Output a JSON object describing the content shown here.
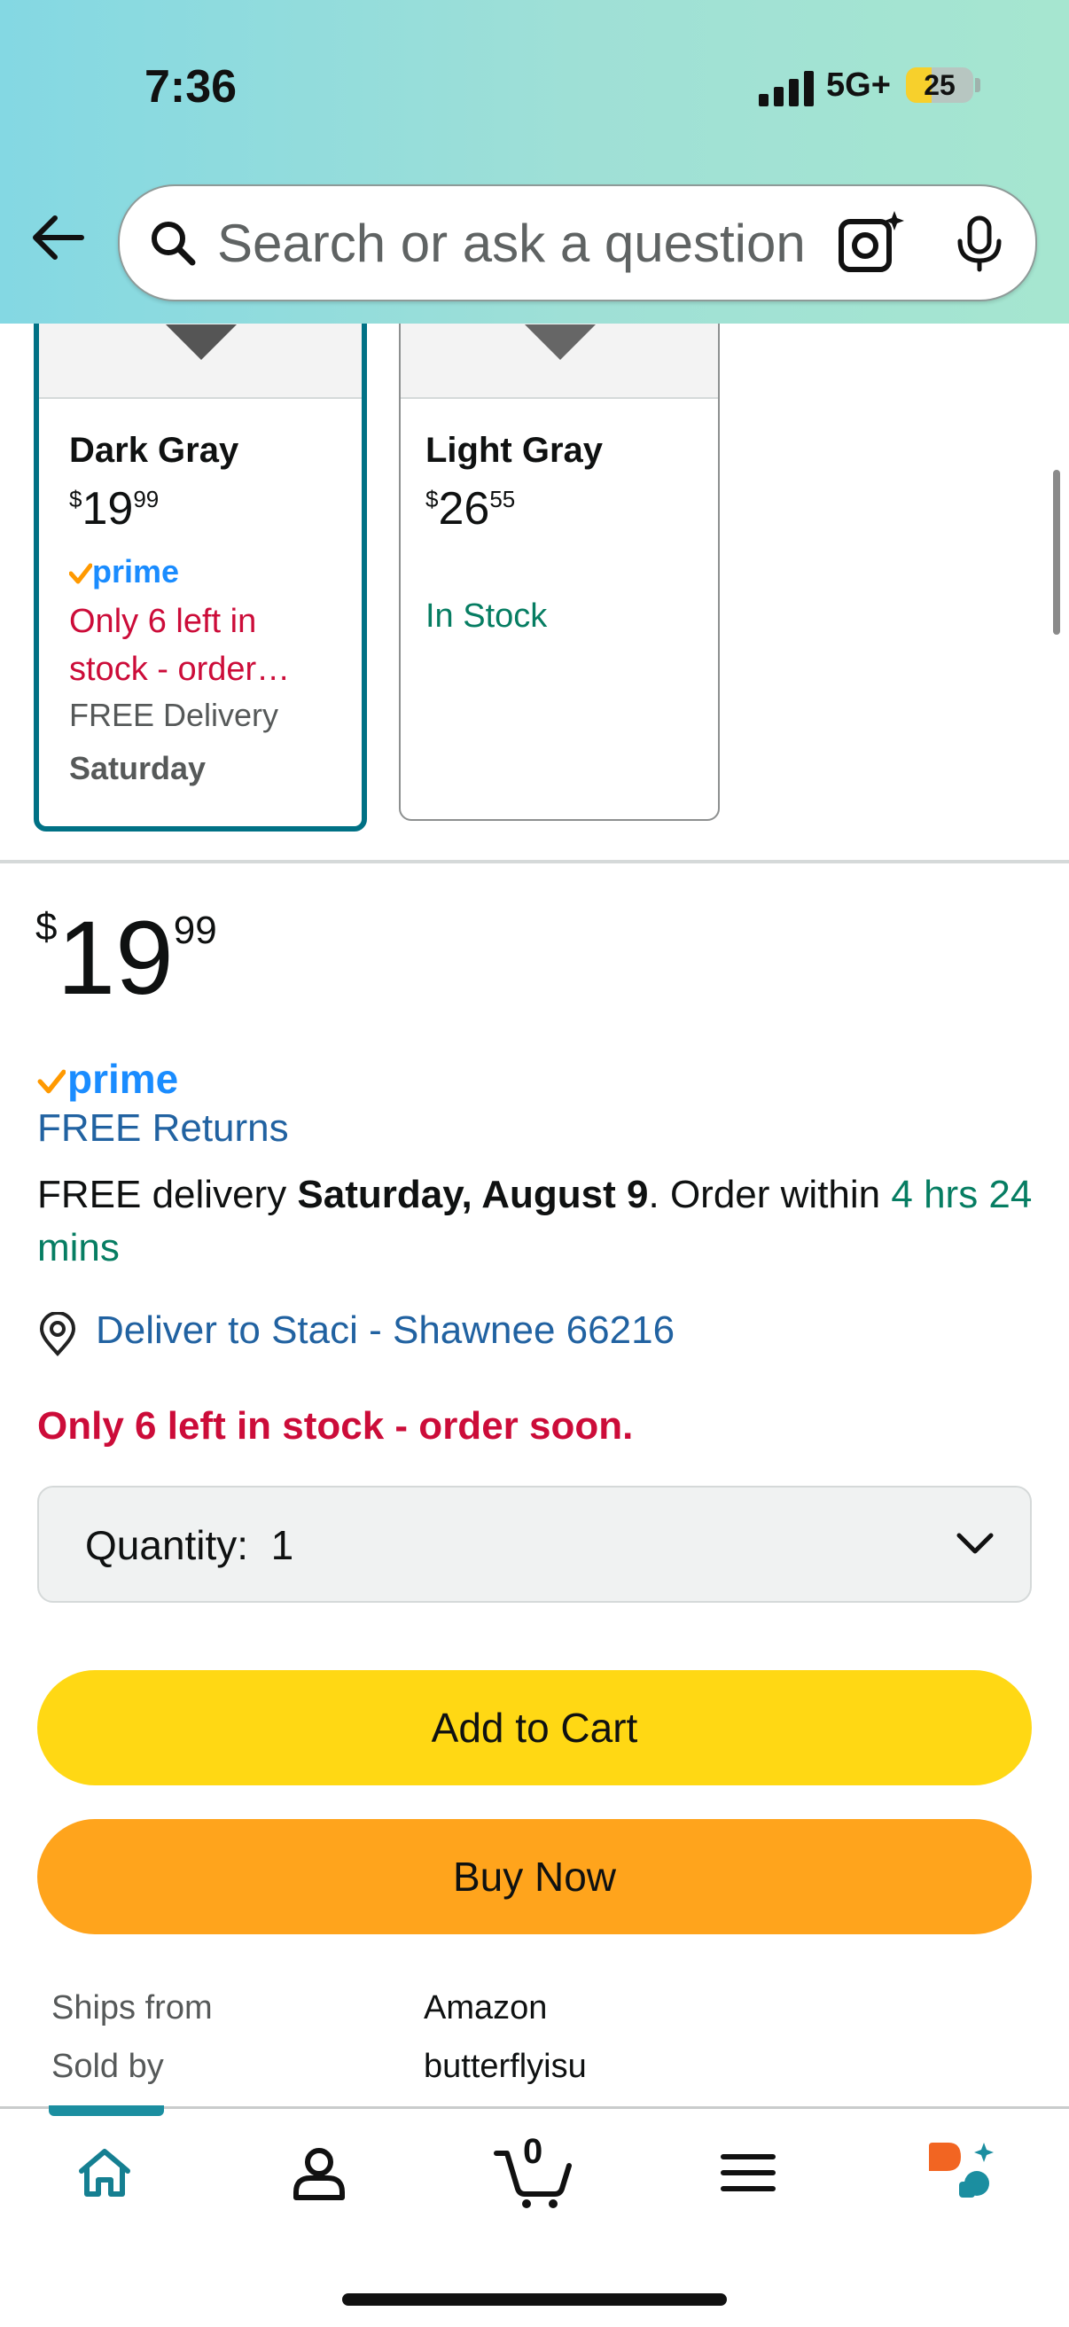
{
  "status_bar": {
    "time": "7:36",
    "network": "5G+",
    "battery": "25"
  },
  "search": {
    "placeholder": "Search or ask a question"
  },
  "variants": [
    {
      "name": "Dark Gray",
      "price_dollars": "19",
      "price_cents": "99",
      "currency": "$",
      "prime": "prime",
      "stock": "Only 6 left in stock - order…",
      "delivery": "FREE Delivery",
      "delivery_day": "Saturday",
      "selected": true
    },
    {
      "name": "Light Gray",
      "price_dollars": "26",
      "price_cents": "55",
      "currency": "$",
      "stock": "In Stock",
      "selected": false
    }
  ],
  "offer": {
    "currency": "$",
    "price_dollars": "19",
    "price_cents": "99",
    "prime": "prime",
    "free_returns": "FREE Returns",
    "delivery_prefix": "FREE delivery ",
    "delivery_date": "Saturday, August 9",
    "delivery_mid": ". Order within ",
    "delivery_window": "4 hrs 24 mins",
    "deliver_to": "Deliver to Staci - Shawnee 66216",
    "stock_warning": "Only 6 left in stock - order soon.",
    "quantity_label": "Quantity:",
    "quantity_value": "1",
    "add_to_cart": "Add to Cart",
    "buy_now": "Buy Now",
    "ships_from_label": "Ships from",
    "ships_from_value": "Amazon",
    "sold_by_label": "Sold by",
    "sold_by_value": "butterflyisu"
  },
  "bottom_nav": {
    "cart_count": "0",
    "items": [
      "home-icon",
      "account-icon",
      "cart-icon",
      "menu-icon",
      "rufus-icon"
    ]
  },
  "colors": {
    "add_to_cart": "#ffd814",
    "buy_now": "#ffa41c",
    "link": "#2162a1",
    "in_stock_green": "#067d62",
    "warning_red": "#cc0c39",
    "selected_border": "#007185",
    "prime_blue": "#1a8cff",
    "prime_check": "#ff9900"
  }
}
